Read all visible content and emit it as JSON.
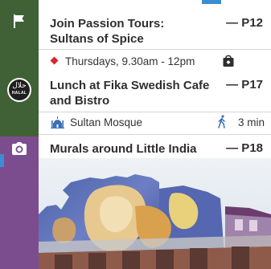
{
  "items": [
    {
      "icon": "flag-icon",
      "title": "Join Passion Tours: Sultans of Spice",
      "page_ref": "— P12",
      "schedule": "Thursdays, 9.30am - 12pm",
      "extra_icon": "shopping-bag-icon"
    },
    {
      "icon": "halal-icon",
      "halal_arabic": "حلال",
      "halal_label": "HALAL",
      "title": "Lunch at Fika Swedish Cafe and Bistro",
      "page_ref": "— P17",
      "nearby": "Sultan Mosque",
      "walk_time": "3 min"
    },
    {
      "icon": "camera-icon",
      "title": "Murals around Little India",
      "page_ref": "— P18",
      "photo": "mural-photo"
    }
  ],
  "colors": {
    "rail_green": "#3f6135",
    "rail_purple": "#7b4d8f",
    "accent_red": "#d8262e",
    "accent_blue": "#3b8ed0"
  }
}
